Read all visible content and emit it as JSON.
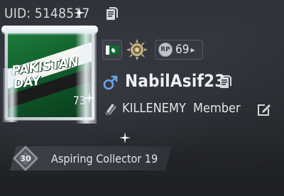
{
  "profile": {
    "uid_label": "UID: 5148517",
    "avatar": {
      "title_line1": "PAKISTAN",
      "title_line2": "DAY",
      "level": "73"
    },
    "badges": {
      "flag": "pakistan-flag-icon",
      "emblem": "tier-emblem-icon",
      "rp_label": "RP",
      "rp_level": "69"
    },
    "name": "NabilAsif23",
    "gender_icon": "male-symbol-icon",
    "clan": {
      "name": "KILLENEMY",
      "role": "Member"
    },
    "collector": {
      "emblem_text": "30",
      "label": "Aspiring Collector 19"
    }
  },
  "colors": {
    "background": "#2c2e33",
    "text": "#e8e8ea",
    "gender_icon": "#6aa6e8",
    "flag_green": "#0d6b2e"
  }
}
